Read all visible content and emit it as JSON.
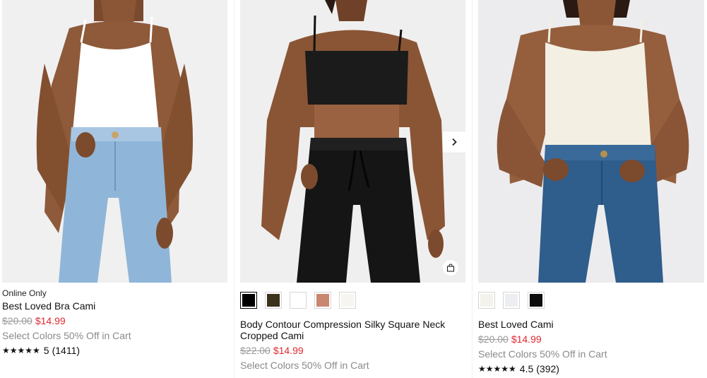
{
  "colors": {
    "sale": "#e0282f",
    "muted": "#8a8a8a",
    "strike": "#9a9a9a"
  },
  "products": [
    {
      "badge": "Online Only",
      "name": "Best Loved Bra Cami",
      "price_original": "$20.00",
      "price_sale": "$14.99",
      "promo": "Select Colors 50% Off in Cart",
      "stars": "★★★★★",
      "rating": "5",
      "reviews": "(1411)"
    },
    {
      "name": "Body Contour Compression Silky Square Neck Cropped Cami",
      "price_original": "$22.00",
      "price_sale": "$14.99",
      "promo": "Select Colors 50% Off in Cart",
      "swatches": [
        "#000000",
        "#3b321c",
        "#ffffff",
        "#c9876f",
        "#f7f5ef"
      ],
      "selected_swatch": 0,
      "icons": {
        "next": "chevron-right-icon",
        "bag": "shopping-bag-icon"
      }
    },
    {
      "name": "Best Loved Cami",
      "price_original": "$20.00",
      "price_sale": "$14.99",
      "promo": "Select Colors 50% Off in Cart",
      "stars": "★★★★★",
      "rating": "4.5",
      "reviews": "(392)",
      "swatches": [
        "#f4f2ec",
        "#eceef3",
        "#0d0d0d"
      ]
    }
  ]
}
